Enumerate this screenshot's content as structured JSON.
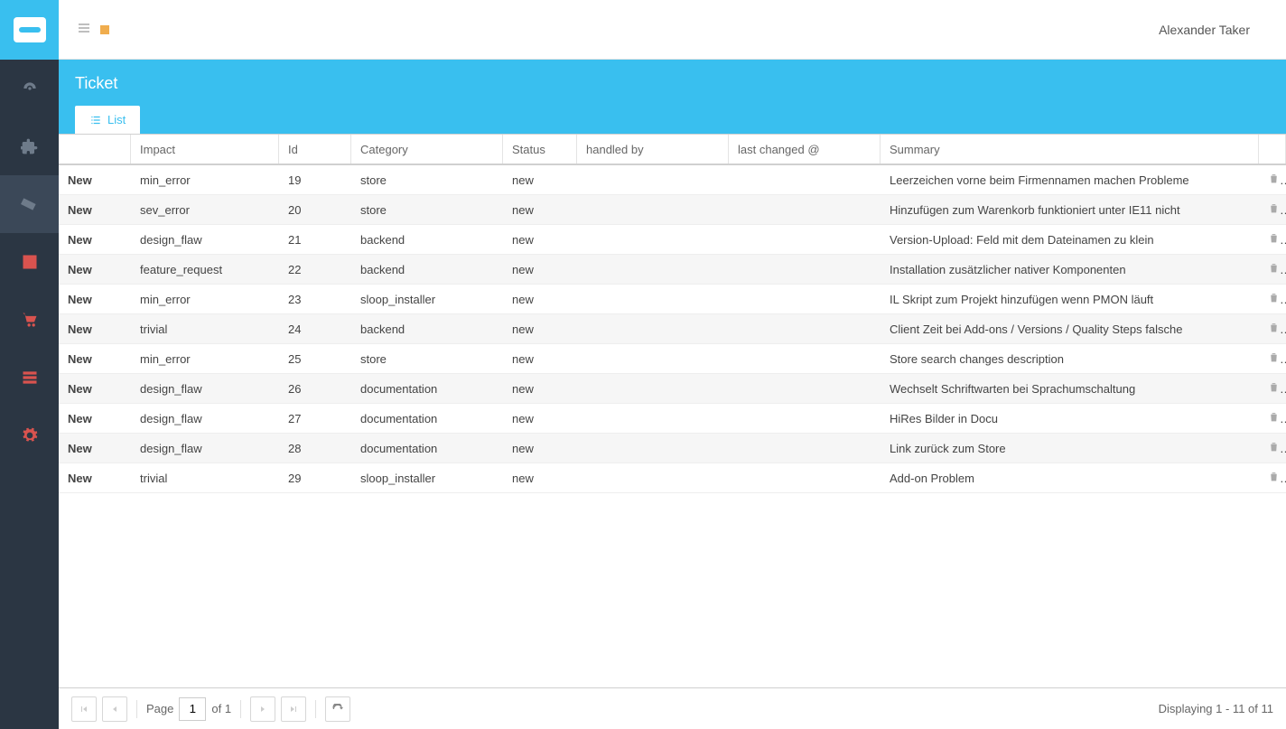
{
  "header": {
    "user_name": "Alexander Taker",
    "page_title": "Ticket",
    "list_tab": "List"
  },
  "columns": {
    "impact": "Impact",
    "id": "Id",
    "category": "Category",
    "status": "Status",
    "handled_by": "handled by",
    "last_changed": "last changed @",
    "summary": "Summary"
  },
  "rows": [
    {
      "new": "New",
      "impact": "min_error",
      "id": "19",
      "category": "store",
      "status": "new",
      "handled": "",
      "changed": "",
      "summary": "Leerzeichen vorne beim Firmennamen machen Probleme"
    },
    {
      "new": "New",
      "impact": "sev_error",
      "id": "20",
      "category": "store",
      "status": "new",
      "handled": "",
      "changed": "",
      "summary": "Hinzufügen zum Warenkorb funktioniert unter IE11 nicht"
    },
    {
      "new": "New",
      "impact": "design_flaw",
      "id": "21",
      "category": "backend",
      "status": "new",
      "handled": "",
      "changed": "",
      "summary": "Version-Upload: Feld mit dem Dateinamen zu klein"
    },
    {
      "new": "New",
      "impact": "feature_request",
      "id": "22",
      "category": "backend",
      "status": "new",
      "handled": "",
      "changed": "",
      "summary": "Installation zusätzlicher nativer Komponenten"
    },
    {
      "new": "New",
      "impact": "min_error",
      "id": "23",
      "category": "sloop_installer",
      "status": "new",
      "handled": "",
      "changed": "",
      "summary": "IL Skript zum Projekt hinzufügen wenn PMON läuft"
    },
    {
      "new": "New",
      "impact": "trivial",
      "id": "24",
      "category": "backend",
      "status": "new",
      "handled": "",
      "changed": "",
      "summary": "Client Zeit bei Add-ons / Versions / Quality Steps falsche"
    },
    {
      "new": "New",
      "impact": "min_error",
      "id": "25",
      "category": "store",
      "status": "new",
      "handled": "",
      "changed": "",
      "summary": "Store search changes description"
    },
    {
      "new": "New",
      "impact": "design_flaw",
      "id": "26",
      "category": "documentation",
      "status": "new",
      "handled": "",
      "changed": "",
      "summary": "Wechselt Schriftwarten bei Sprachumschaltung"
    },
    {
      "new": "New",
      "impact": "design_flaw",
      "id": "27",
      "category": "documentation",
      "status": "new",
      "handled": "",
      "changed": "",
      "summary": "HiRes Bilder in Docu"
    },
    {
      "new": "New",
      "impact": "design_flaw",
      "id": "28",
      "category": "documentation",
      "status": "new",
      "handled": "",
      "changed": "",
      "summary": "Link zurück zum Store"
    },
    {
      "new": "New",
      "impact": "trivial",
      "id": "29",
      "category": "sloop_installer",
      "status": "new",
      "handled": "",
      "changed": "",
      "summary": "Add-on Problem"
    }
  ],
  "pager": {
    "page_label": "Page",
    "current": "1",
    "of_label": "of 1",
    "display": "Displaying 1 - 11 of 11"
  }
}
